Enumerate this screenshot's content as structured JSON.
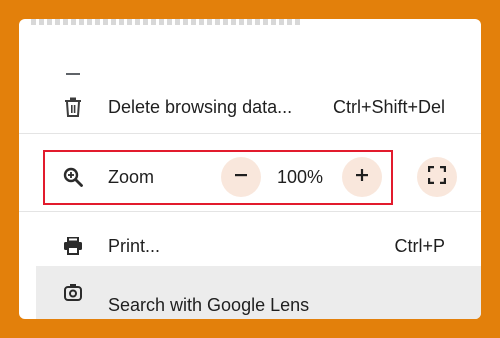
{
  "menu": {
    "delete_browsing": {
      "label": "Delete browsing data...",
      "shortcut": "Ctrl+Shift+Del",
      "icon": "trash-icon"
    },
    "zoom": {
      "label": "Zoom",
      "value": "100%",
      "icon": "zoom-in-icon",
      "minus_icon": "minus-icon",
      "plus_icon": "plus-icon",
      "fullscreen_icon": "fullscreen-icon"
    },
    "print": {
      "label": "Print...",
      "shortcut": "Ctrl+P",
      "icon": "printer-icon"
    },
    "search_lens": {
      "label": "Search with Google Lens",
      "icon": "lens-icon"
    }
  },
  "colors": {
    "frame": "#e3800b",
    "highlight": "#e21b2d",
    "zoom_button_bg": "#f9e7dc"
  }
}
